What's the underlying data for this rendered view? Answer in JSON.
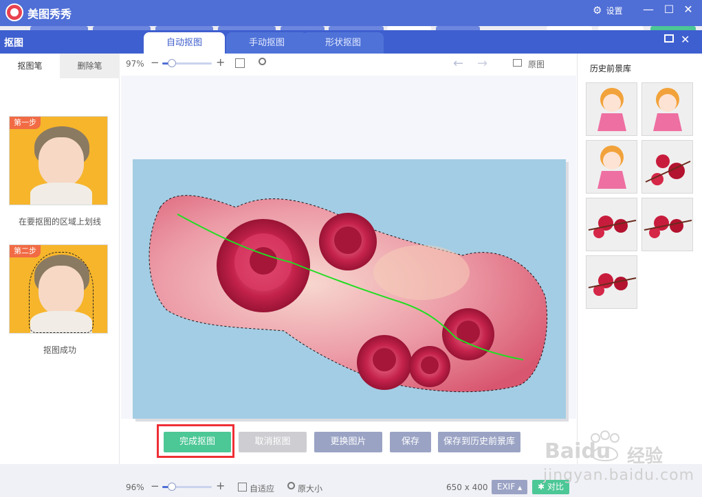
{
  "app": {
    "title": "美图秀秀",
    "settings_label": "设置"
  },
  "dialog": {
    "title": "抠图",
    "tabs": [
      {
        "label": "自动抠图",
        "active": true
      },
      {
        "label": "手动抠图",
        "active": false
      },
      {
        "label": "形状抠图",
        "active": false
      }
    ]
  },
  "left_panel": {
    "tabs": [
      {
        "label": "抠图笔"
      },
      {
        "label": "删除笔"
      }
    ],
    "steps": [
      {
        "badge": "第一步",
        "caption": "在要抠图的区域上划线"
      },
      {
        "badge": "第二步",
        "caption": "抠图成功"
      }
    ]
  },
  "toolbar": {
    "zoom": "97%",
    "original_label": "原图",
    "zoom_level": 0.2
  },
  "actions": {
    "finish": "完成抠图",
    "cancel": "取消抠图",
    "replace": "更换图片",
    "save": "保存",
    "save_to_library": "保存到历史前景库"
  },
  "history": {
    "title": "历史前景库",
    "items": [
      "cartoon-girl",
      "cartoon-girl",
      "cartoon-girl",
      "red-flowers",
      "red-flowers",
      "red-flowers",
      "red-flowers"
    ]
  },
  "statusbar": {
    "zoom": "96%",
    "fit_label": "自适应",
    "original_size_label": "原大小",
    "image_size": "650 x 400",
    "exif_label": "EXIF",
    "compare_label": "对比",
    "zoom_level": 0.2
  },
  "watermark": {
    "brand": "Baidu",
    "suffix": "经验",
    "url": "jingyan.baidu.com"
  },
  "colors": {
    "app_bar": "#4f6ed6",
    "dialog_bar": "#3e5fcf",
    "finish_button": "#4cc796",
    "highlight_frame": "#ee2e34",
    "canvas_bg": "#a3cde4",
    "stroke_line": "#22dd22"
  }
}
